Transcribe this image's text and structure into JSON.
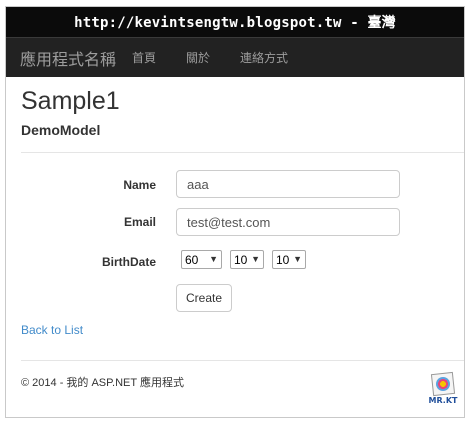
{
  "banner": {
    "url_text": "http://kevintsengtw.blogspot.tw - 臺灣"
  },
  "navbar": {
    "brand": "應用程式名稱",
    "links": [
      "首頁",
      "關於",
      "連絡方式"
    ]
  },
  "page": {
    "title": "Sample1",
    "subtitle": "DemoModel"
  },
  "form": {
    "name_label": "Name",
    "name_value": "aaa",
    "email_label": "Email",
    "email_value": "test@test.com",
    "birthdate_label": "BirthDate",
    "birth_year": "60",
    "birth_month": "10",
    "birth_day": "10",
    "submit_label": "Create"
  },
  "back_link": "Back to List",
  "footer": {
    "text": "© 2014 - 我的 ASP.NET 應用程式"
  },
  "logo": {
    "text": "MR.KT",
    "icon": "mrkt-logo-icon"
  },
  "colors": {
    "navbar": "#222222",
    "link": "#428bca",
    "banner": "#0b0b0b"
  }
}
